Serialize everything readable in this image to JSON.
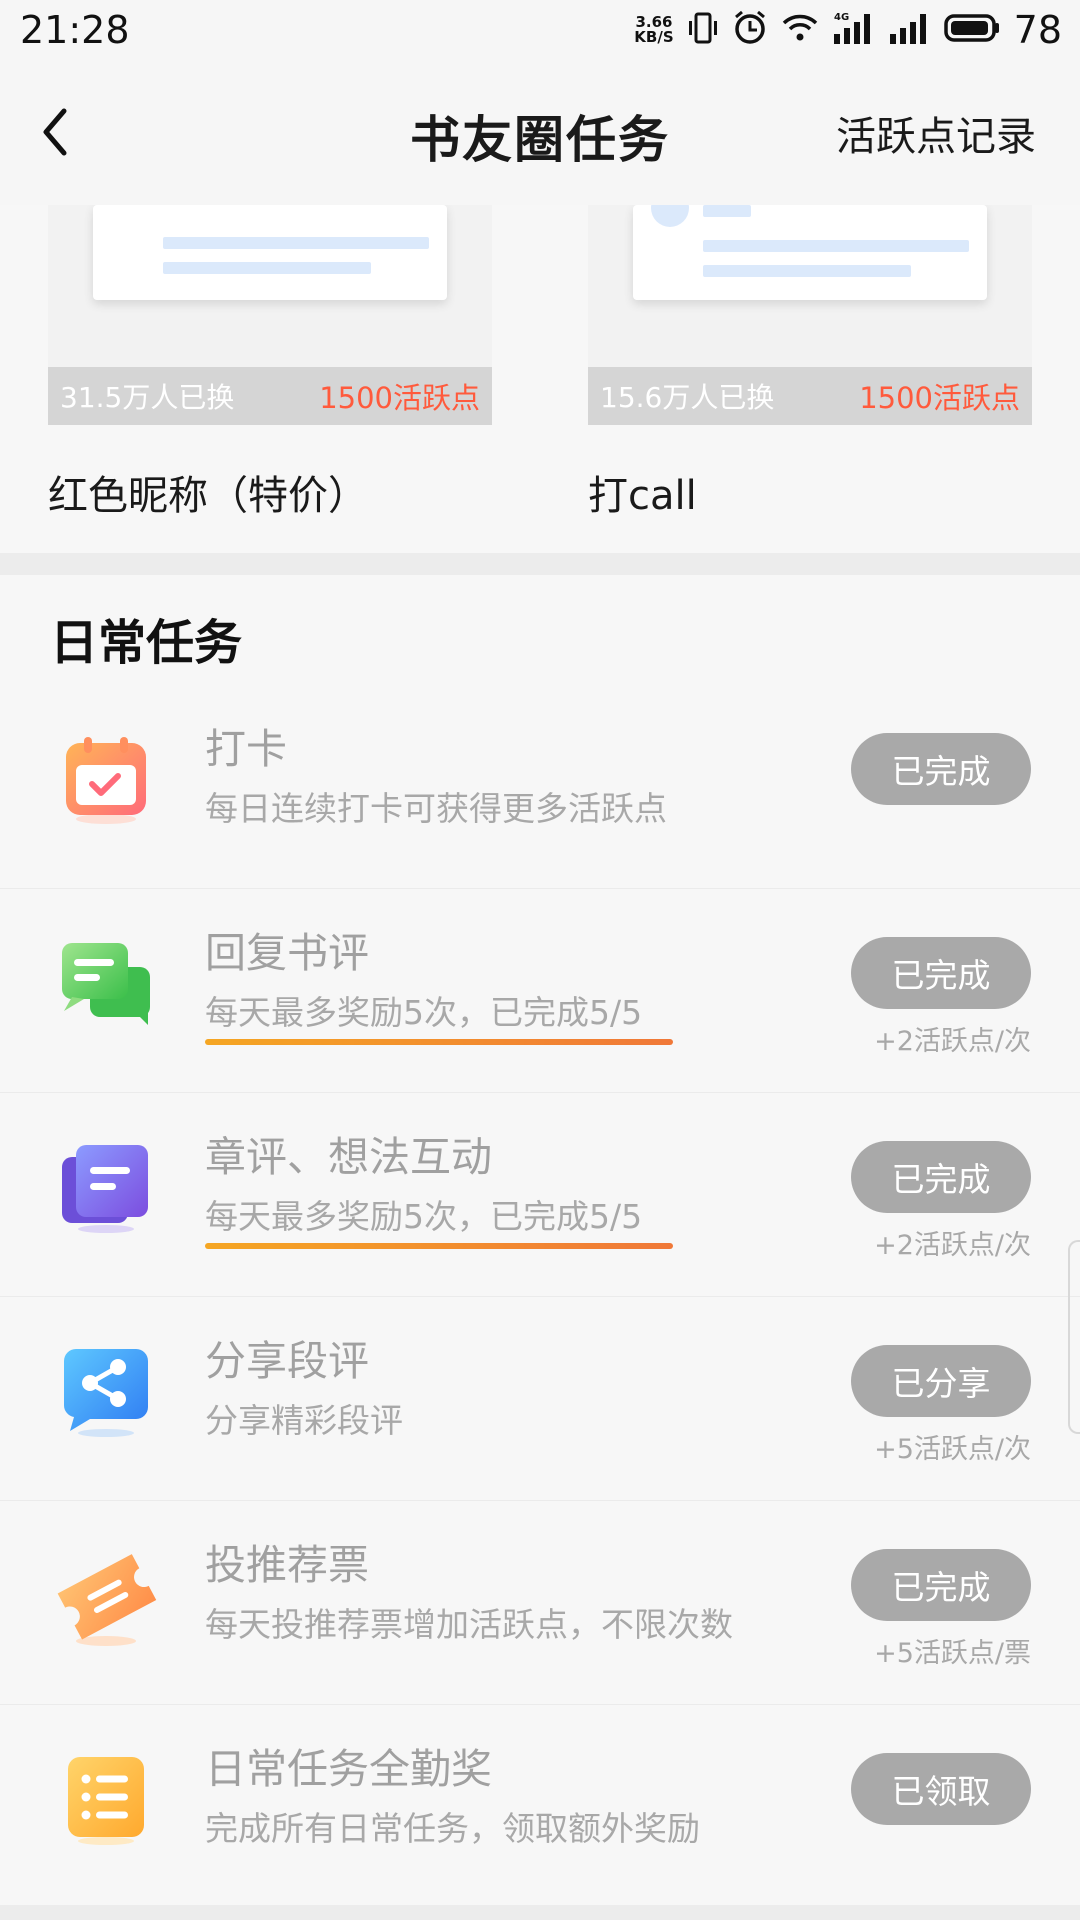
{
  "status_bar": {
    "time": "21:28",
    "speed_top": "3.66",
    "speed_bottom": "KB/S",
    "battery": "78",
    "icons": [
      "vibrate-icon",
      "alarm-icon",
      "wifi-icon",
      "signal-4g-icon",
      "signal-icon",
      "battery-icon"
    ]
  },
  "header": {
    "title": "书友圈任务",
    "record_label": "活跃点记录",
    "back_icon": "chevron-left-icon"
  },
  "rewards": [
    {
      "count": "31.5万人已换",
      "cost": "1500活跃点",
      "title": "红色昵称（特价）"
    },
    {
      "count": "15.6万人已换",
      "cost": "1500活跃点",
      "title": "打call"
    }
  ],
  "daily": {
    "title": "日常任务",
    "tasks": [
      {
        "name": "打卡",
        "desc": "每日连续打卡可获得更多活跃点",
        "button": "已完成",
        "reward": "",
        "icon": "calendar-check-icon",
        "progress": null
      },
      {
        "name": "回复书评",
        "desc": "每天最多奖励5次，已完成5/5",
        "button": "已完成",
        "reward": "+2活跃点/次",
        "icon": "chat-bubble-icon",
        "progress": 1.0
      },
      {
        "name": "章评、想法互动",
        "desc": "每天最多奖励5次，已完成5/5",
        "button": "已完成",
        "reward": "+2活跃点/次",
        "icon": "comment-card-icon",
        "progress": 1.0
      },
      {
        "name": "分享段评",
        "desc": "分享精彩段评",
        "button": "已分享",
        "reward": "+5活跃点/次",
        "icon": "share-icon",
        "progress": null
      },
      {
        "name": "投推荐票",
        "desc": "每天投推荐票增加活跃点，不限次数",
        "button": "已完成",
        "reward": "+5活跃点/票",
        "icon": "ticket-icon",
        "progress": null
      },
      {
        "name": "日常任务全勤奖",
        "desc": "完成所有日常任务，领取额外奖励",
        "button": "已领取",
        "reward": "",
        "icon": "list-icon",
        "progress": null
      }
    ]
  },
  "colors": {
    "accent_red": "#ff5a3c",
    "progress_start": "#f5a623",
    "progress_end": "#f07838",
    "button_done": "#a9a9a9"
  }
}
